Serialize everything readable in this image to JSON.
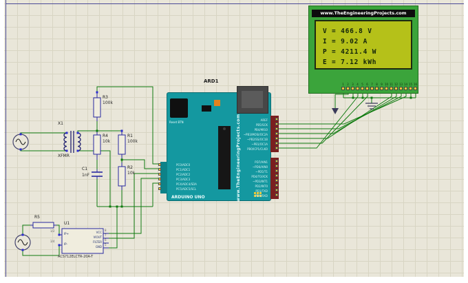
{
  "lcd": {
    "brand_text": "www.TheEngineeringProjects.com",
    "screen_lines": [
      "V = 466.8 V",
      "I = 9.02 A",
      "P = 4211.4 W",
      "E = 7.12 kWh"
    ],
    "pin_numbers": [
      "1",
      "2",
      "3",
      "4",
      "5",
      "6",
      "7",
      "8",
      "9",
      "10",
      "11",
      "12",
      "13",
      "14",
      "15",
      "16"
    ]
  },
  "arduino": {
    "ref": "ARD1",
    "board_url": "www.TheEngineeringProjects.com",
    "board_name": "ARDUINO UNO",
    "reset_label": "Reset BTN",
    "right_pins_upper": [
      "AREF",
      "PB5/SCK",
      "PB4/MISO",
      "~PB3/MOSI/OC2A",
      "~PB2/SS/OC1B",
      "~PB1/OC1A",
      "PB0/ICP1/CLKO"
    ],
    "right_pins_lower": [
      "PD7/AIN1",
      "~PD6/AIN0",
      "~PD5/T1",
      "PD4/T0/XCK",
      "~PD3/INT1",
      "PD2/INT0",
      "PD1/TXD",
      "PD0/RXD"
    ],
    "left_pins": [
      "PC0/ADC0",
      "PC1/ADC1",
      "PC2/ADC2",
      "PC3/ADC3",
      "PC4/ADC4/SDA",
      "PC5/ADC5/SCL"
    ]
  },
  "components": {
    "transformer": {
      "ref": "X1",
      "value": "XFMR"
    },
    "r1": {
      "ref": "R1",
      "value": "100k"
    },
    "r2": {
      "ref": "R2",
      "value": "10k"
    },
    "r3": {
      "ref": "R3",
      "value": "100k"
    },
    "r4": {
      "ref": "R4",
      "value": "10k"
    },
    "c1": {
      "ref": "C1",
      "value": "1nF"
    },
    "r5": {
      "ref": "R5"
    },
    "u1": {
      "ref": "U1",
      "value": "ACS712ELCTR-20A-T",
      "left_pins": [
        "IP+",
        "IP-"
      ],
      "right_pins": [
        "VCC",
        "VIOUT",
        "FILTER",
        "GND"
      ],
      "left_pin_numbers": [
        "1/2",
        "3/4"
      ],
      "right_pin_numbers": [
        "8",
        "7",
        "6",
        "5"
      ]
    }
  },
  "colors": {
    "wire_green": "#0f7a0f",
    "component_blue": "#2828a0",
    "board_teal": "#1498a0",
    "lcd_pcb_green": "#3ba43b",
    "lcd_screen_yellow": "#b5c119",
    "pin_yellow": "#e8c83a",
    "grid_bg": "#e9e6d9"
  }
}
